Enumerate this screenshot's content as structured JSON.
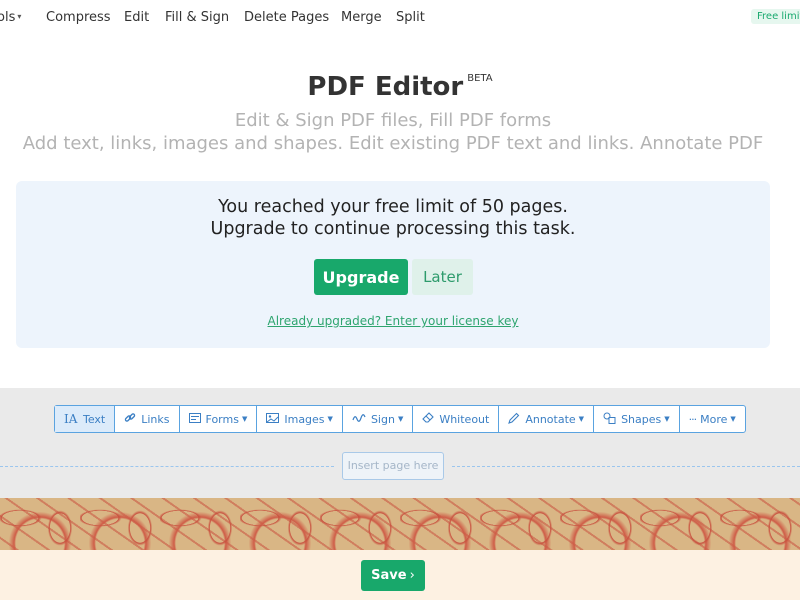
{
  "nav": {
    "tools_label": "ols",
    "items": [
      "Compress",
      "Edit",
      "Fill & Sign",
      "Delete Pages",
      "Merge",
      "Split"
    ],
    "free_badge": "Free limite"
  },
  "header": {
    "title": "PDF Editor",
    "beta": "BETA",
    "subtitle1": "Edit & Sign PDF files, Fill PDF forms",
    "subtitle2": "Add text, links, images and shapes. Edit existing PDF text and links. Annotate PDF"
  },
  "limit": {
    "line1": "You reached your free limit of 50 pages.",
    "line2": "Upgrade to continue processing this task.",
    "upgrade_label": "Upgrade",
    "later_label": "Later",
    "license_link": "Already upgraded? Enter your license key"
  },
  "toolbar": {
    "items": [
      {
        "label": "Text",
        "icon": "text-cursor-icon",
        "active": true
      },
      {
        "label": "Links",
        "icon": "link-icon"
      },
      {
        "label": "Forms",
        "icon": "form-icon",
        "dropdown": true
      },
      {
        "label": "Images",
        "icon": "image-icon",
        "dropdown": true
      },
      {
        "label": "Sign",
        "icon": "signature-icon",
        "dropdown": true
      },
      {
        "label": "Whiteout",
        "icon": "eraser-icon"
      },
      {
        "label": "Annotate",
        "icon": "pencil-icon",
        "dropdown": true
      },
      {
        "label": "Shapes",
        "icon": "shapes-icon",
        "dropdown": true
      },
      {
        "label": "More",
        "icon": "more-icon",
        "dropdown": true
      }
    ],
    "insert_page": "Insert page here"
  },
  "footer": {
    "save_label": "Save"
  },
  "colors": {
    "accent": "#18a86b",
    "toolbar_blue": "#3b7fc4",
    "limit_bg": "#edf4fc"
  }
}
